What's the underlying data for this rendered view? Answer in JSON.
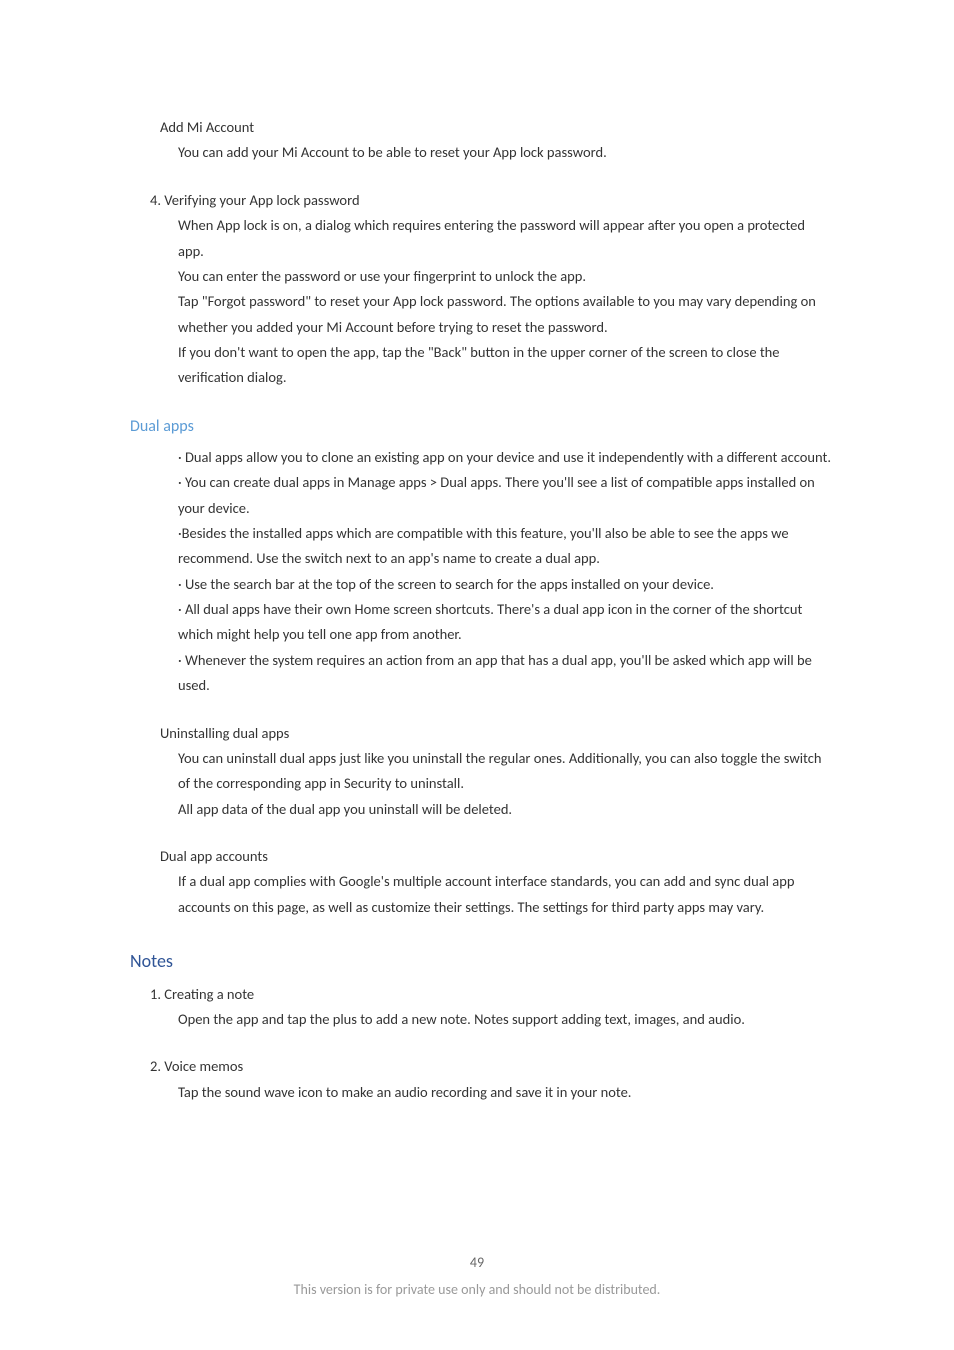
{
  "section_add_mi": {
    "title": "Add Mi Account",
    "body": "You can add your Mi Account to be able to reset your App lock password."
  },
  "section_verify": {
    "title": "4. Verifying your App lock password",
    "p1": "When App lock is on, a dialog which requires entering the password will appear after you open a protected app.",
    "p2": "You can enter the password or use your fingerprint to unlock the app.",
    "p3": "Tap \"Forgot password\" to reset your App lock password. The options available to you may vary depending on whether you added your Mi Account before trying to reset the password.",
    "p4": "If you don't want to open the app, tap the \"Back\" button in the upper corner of the screen to close the verification dialog."
  },
  "dual_apps": {
    "heading": "Dual apps",
    "b1": "· Dual apps allow you to clone an existing app on your device and use it independently with a different account.",
    "b2": "· You can create dual apps in Manage apps > Dual apps. There you'll see a list of compatible apps installed on your device.",
    "b3": "·Besides the installed apps which are compatible with this feature, you'll also be able to see the apps we recommend. Use the switch next to an app's name to create a dual app.",
    "b4": "· Use the search bar at the top of the screen to search for the apps installed on your device.",
    "b5": "· All dual apps have their own Home screen shortcuts. There's a dual app icon in the corner of the shortcut which might help you tell one app from another.",
    "b6": "· Whenever the system requires an action from an app that has a dual app, you'll be asked which app will be used."
  },
  "uninstall": {
    "title": "Uninstalling dual apps",
    "p1": "You can uninstall dual apps just like you uninstall the regular ones. Additionally, you can also toggle the switch of the corresponding app in Security to uninstall.",
    "p2": "All app data of the dual app you uninstall will be deleted."
  },
  "dual_accounts": {
    "title": "Dual app accounts",
    "p1": "If a dual app complies with Google's multiple account interface standards, you can add and sync dual app accounts on this page, as well as customize their settings. The settings for third party apps may vary."
  },
  "notes": {
    "heading": "Notes",
    "s1_title": "1. Creating a note",
    "s1_body": "Open the app and tap the plus to add a new note. Notes support adding text, images, and audio.",
    "s2_title": "2. Voice memos",
    "s2_body": "Tap the sound wave icon to make an audio recording and save it in your note."
  },
  "footer": {
    "page": "49",
    "disclaimer": "This version is for private use only and should not be distributed."
  }
}
